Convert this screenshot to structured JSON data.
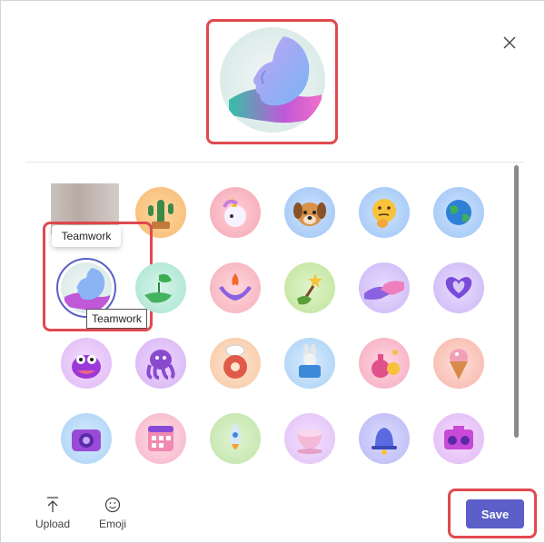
{
  "dialog": {
    "close_icon": "close-icon",
    "preview_name": "Teamwork",
    "tooltip_text": "Teamwork",
    "selected_label": "Teamwork"
  },
  "grid": {
    "items": [
      {
        "name": "photo-thumbnail"
      },
      {
        "name": "cactus"
      },
      {
        "name": "unicorn"
      },
      {
        "name": "dog"
      },
      {
        "name": "thinking-face"
      },
      {
        "name": "globe"
      },
      {
        "name": "teamwork"
      },
      {
        "name": "plant-hand"
      },
      {
        "name": "fire-hands"
      },
      {
        "name": "wand"
      },
      {
        "name": "handshake"
      },
      {
        "name": "heart-hands"
      },
      {
        "name": "monster"
      },
      {
        "name": "octopus"
      },
      {
        "name": "donut-chef"
      },
      {
        "name": "bunny-hat"
      },
      {
        "name": "potion"
      },
      {
        "name": "ice-cream"
      },
      {
        "name": "camera"
      },
      {
        "name": "calendar"
      },
      {
        "name": "rocket"
      },
      {
        "name": "teacup"
      },
      {
        "name": "bell"
      },
      {
        "name": "boombox"
      }
    ]
  },
  "footer": {
    "upload_label": "Upload",
    "emoji_label": "Emoji",
    "save_label": "Save"
  },
  "colors": {
    "accent": "#5b5fc7",
    "highlight": "#e0494f"
  }
}
